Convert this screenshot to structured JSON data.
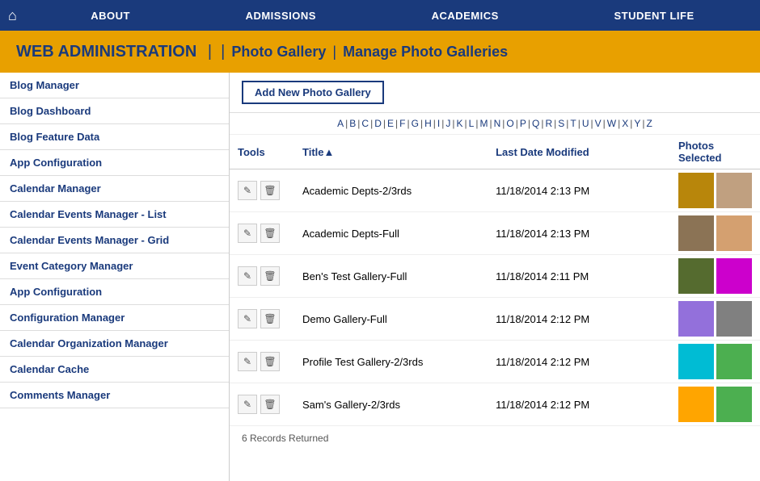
{
  "topnav": {
    "home_icon": "⌂",
    "items": [
      {
        "label": "ABOUT"
      },
      {
        "label": "ADMISSIONS"
      },
      {
        "label": "ACADEMICS"
      },
      {
        "label": "STUDENT LIFE"
      }
    ]
  },
  "header": {
    "web_admin": "WEB ADMINISTRATION",
    "separator": "|",
    "photo_gallery": "Photo Gallery",
    "manage": "Manage Photo Galleries"
  },
  "sidebar": {
    "items": [
      {
        "label": "Blog Manager"
      },
      {
        "label": "Blog Dashboard"
      },
      {
        "label": "Blog Feature Data"
      },
      {
        "label": "App Configuration"
      },
      {
        "label": "Calendar Manager"
      },
      {
        "label": "Calendar Events Manager - List"
      },
      {
        "label": "Calendar Events Manager - Grid"
      },
      {
        "label": "Event Category Manager"
      },
      {
        "label": "App Configuration"
      },
      {
        "label": "Configuration Manager"
      },
      {
        "label": "Calendar Organization Manager"
      },
      {
        "label": "Calendar Cache"
      },
      {
        "label": "Comments Manager"
      }
    ]
  },
  "content": {
    "add_button": "Add New Photo Gallery",
    "alphabet": [
      "A",
      "B",
      "C",
      "D",
      "E",
      "F",
      "G",
      "H",
      "I",
      "J",
      "K",
      "L",
      "M",
      "N",
      "O",
      "P",
      "Q",
      "R",
      "S",
      "T",
      "U",
      "V",
      "W",
      "X",
      "Y",
      "Z"
    ],
    "columns": {
      "tools": "Tools",
      "title": "Title",
      "title_sort": "▲",
      "last_modified": "Last Date Modified",
      "photos_selected": "Photos Selected"
    },
    "rows": [
      {
        "title": "Academic Depts-2/3rds",
        "date": "11/18/2014 2:13 PM",
        "thumb1_color": "#b8860b",
        "thumb2_color": "#c0a080"
      },
      {
        "title": "Academic Depts-Full",
        "date": "11/18/2014 2:13 PM",
        "thumb1_color": "#8b7355",
        "thumb2_color": "#d4a070"
      },
      {
        "title": "Ben's Test Gallery-Full",
        "date": "11/18/2014 2:11 PM",
        "thumb1_color": "#556b2f",
        "thumb2_color": "#cc00cc"
      },
      {
        "title": "Demo Gallery-Full",
        "date": "11/18/2014 2:12 PM",
        "thumb1_color": "#9370db",
        "thumb2_color": "#808080"
      },
      {
        "title": "Profile Test Gallery-2/3rds",
        "date": "11/18/2014 2:12 PM",
        "thumb1_color": "#00bcd4",
        "thumb2_color": "#4caf50"
      },
      {
        "title": "Sam's Gallery-2/3rds",
        "date": "11/18/2014 2:12 PM",
        "thumb1_color": "#ffa500",
        "thumb2_color": "#4caf50"
      }
    ],
    "records_info": "6 Records Returned",
    "edit_icon": "✎",
    "delete_icon": "🗑"
  },
  "colors": {
    "nav_bg": "#1a3a7c",
    "yellow_bg": "#e8a000",
    "link_color": "#1a3a7c"
  }
}
